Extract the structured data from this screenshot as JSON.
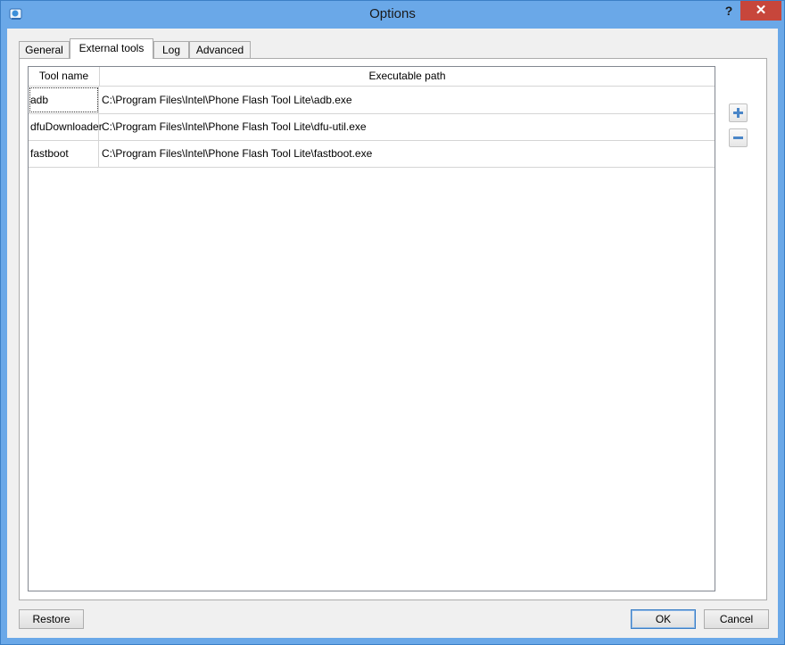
{
  "window": {
    "title": "Options",
    "help_label": "?",
    "close_label": "✕"
  },
  "tabs": [
    {
      "label": "General"
    },
    {
      "label": "External tools"
    },
    {
      "label": "Log"
    },
    {
      "label": "Advanced"
    }
  ],
  "active_tab": "External tools",
  "table": {
    "headers": [
      "Tool name",
      "Executable path"
    ],
    "rows": [
      {
        "name": "adb",
        "path": "C:\\Program Files\\Intel\\Phone Flash Tool Lite\\adb.exe"
      },
      {
        "name": "dfuDownloader",
        "path": "C:\\Program Files\\Intel\\Phone Flash Tool Lite\\dfu-util.exe"
      },
      {
        "name": "fastboot",
        "path": "C:\\Program Files\\Intel\\Phone Flash Tool Lite\\fastboot.exe"
      }
    ]
  },
  "side_buttons": {
    "add_icon": "plus-icon",
    "remove_icon": "minus-icon"
  },
  "buttons": {
    "restore": "Restore",
    "ok": "OK",
    "cancel": "Cancel"
  },
  "colors": {
    "titlebar": "#6aa8e8",
    "close": "#c7463b",
    "accent": "#3c7fc6"
  }
}
